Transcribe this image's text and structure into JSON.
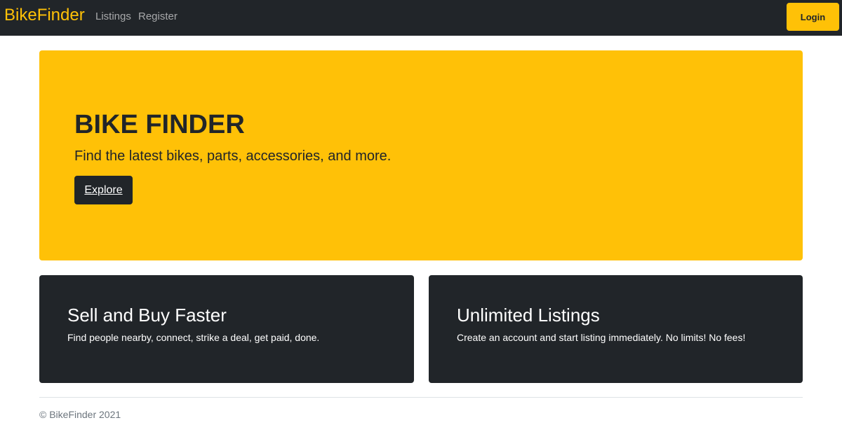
{
  "navbar": {
    "brand": "BikeFinder",
    "links": [
      {
        "label": "Listings"
      },
      {
        "label": "Register"
      }
    ],
    "login_label": "Login"
  },
  "hero": {
    "title": "BIKE FINDER",
    "subtitle": "Find the latest bikes, parts, accessories, and more.",
    "button_label": "Explore"
  },
  "features": [
    {
      "title": "Sell and Buy Faster",
      "text": "Find people nearby, connect, strike a deal, get paid, done."
    },
    {
      "title": "Unlimited Listings",
      "text": "Create an account and start listing immediately. No limits! No fees!"
    }
  ],
  "footer": {
    "copyright": "© BikeFinder 2021"
  },
  "colors": {
    "accent": "#ffc107",
    "dark": "#212529"
  }
}
